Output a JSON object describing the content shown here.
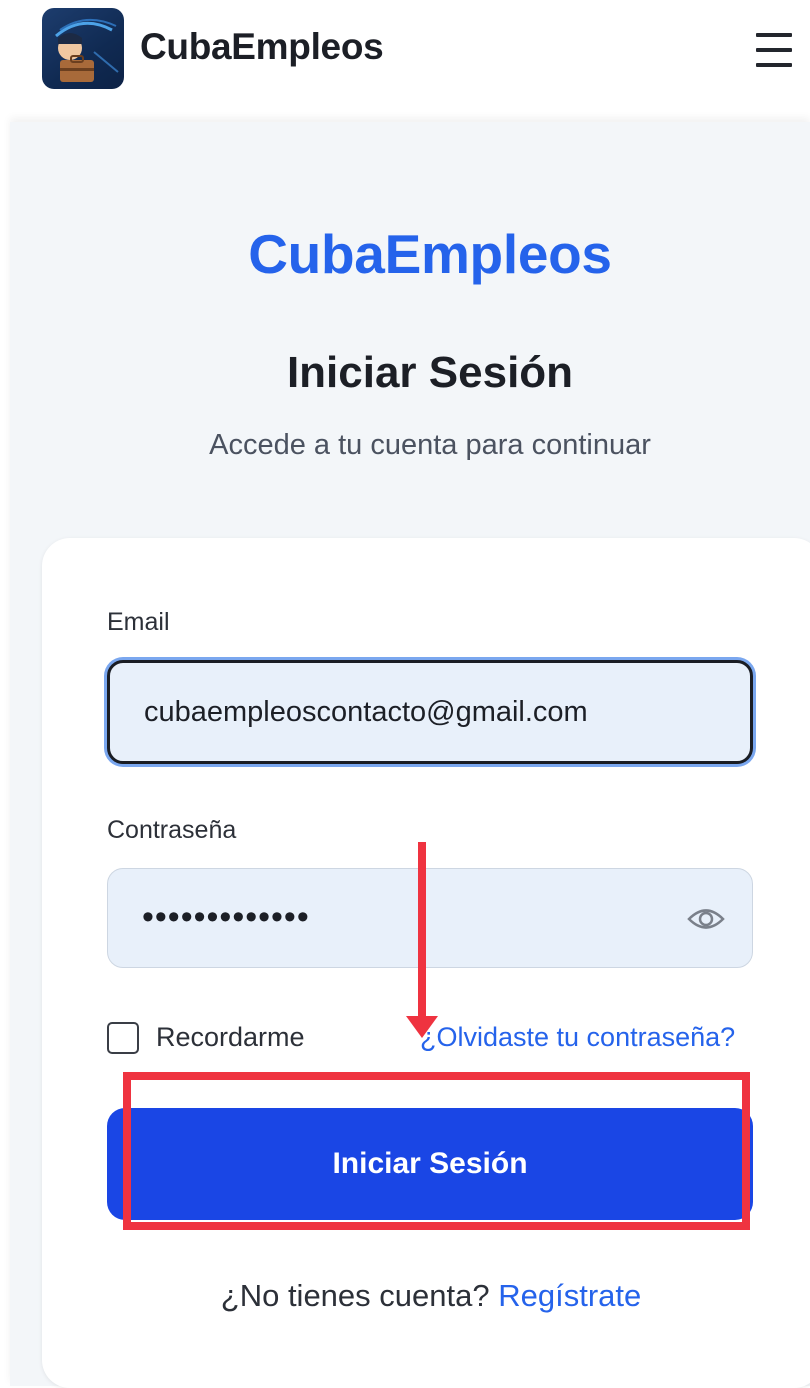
{
  "header": {
    "brand_name": "CubaEmpleos",
    "logo_icon": "briefcase-logo-icon",
    "menu_icon": "hamburger-menu-icon"
  },
  "main": {
    "site_title": "CubaEmpleos",
    "page_title": "Iniciar Sesión",
    "page_subtitle": "Accede a tu cuenta para continuar"
  },
  "login_form": {
    "email_label": "Email",
    "email_value": "cubaempleoscontacto@gmail.com",
    "password_label": "Contraseña",
    "password_value": "•••••••••••••",
    "show_password_icon": "eye-icon",
    "remember_label": "Recordarme",
    "remember_checked": false,
    "forgot_link": "¿Olvidaste tu contraseña?",
    "submit_label": "Iniciar Sesión",
    "signup_prompt": "¿No tienes cuenta?",
    "signup_link": "Regístrate"
  },
  "colors": {
    "accent": "#2563eb",
    "button": "#1a46e5",
    "annotation": "#ef3340"
  }
}
